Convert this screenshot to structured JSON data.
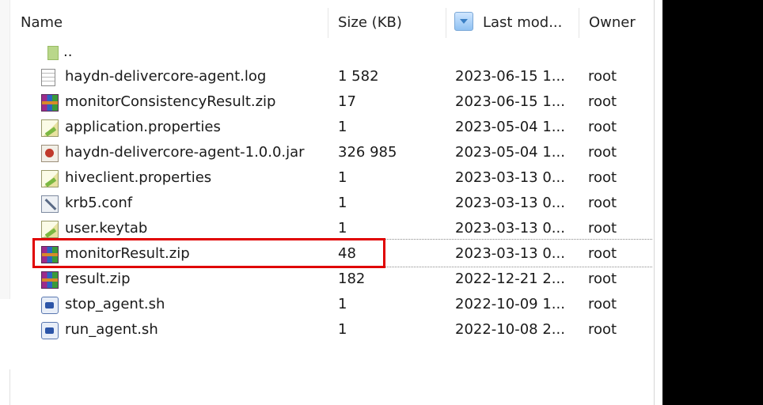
{
  "columns": {
    "name": "Name",
    "size": "Size (KB)",
    "modified": "Last mod...",
    "owner": "Owner"
  },
  "parent_row": {
    "name": ".."
  },
  "files": [
    {
      "name": "haydn-delivercore-agent.log",
      "size": "1 582",
      "modified": "2023-06-15 1...",
      "owner": "root",
      "icon": "log-file-icon"
    },
    {
      "name": "monitorConsistencyResult.zip",
      "size": "17",
      "modified": "2023-06-15 1...",
      "owner": "root",
      "icon": "zip-archive-icon"
    },
    {
      "name": "application.properties",
      "size": "1",
      "modified": "2023-05-04 1...",
      "owner": "root",
      "icon": "properties-file-icon"
    },
    {
      "name": "haydn-delivercore-agent-1.0.0.jar",
      "size": "326 985",
      "modified": "2023-05-04 1...",
      "owner": "root",
      "icon": "jar-file-icon"
    },
    {
      "name": "hiveclient.properties",
      "size": "1",
      "modified": "2023-03-13 0...",
      "owner": "root",
      "icon": "properties-file-icon"
    },
    {
      "name": "krb5.conf",
      "size": "1",
      "modified": "2023-03-13 0...",
      "owner": "root",
      "icon": "config-file-icon"
    },
    {
      "name": "user.keytab",
      "size": "1",
      "modified": "2023-03-13 0...",
      "owner": "root",
      "icon": "properties-file-icon"
    },
    {
      "name": "monitorResult.zip",
      "size": "48",
      "modified": "2023-03-13 0...",
      "owner": "root",
      "icon": "zip-archive-icon",
      "highlighted": true
    },
    {
      "name": "result.zip",
      "size": "182",
      "modified": "2022-12-21 2...",
      "owner": "root",
      "icon": "zip-archive-icon"
    },
    {
      "name": "stop_agent.sh",
      "size": "1",
      "modified": "2022-10-09 1...",
      "owner": "root",
      "icon": "shell-script-icon"
    },
    {
      "name": "run_agent.sh",
      "size": "1",
      "modified": "2022-10-08 2...",
      "owner": "root",
      "icon": "shell-script-icon"
    }
  ],
  "colors": {
    "highlight": "#e00000",
    "header_icon": "#3a7fc4"
  }
}
